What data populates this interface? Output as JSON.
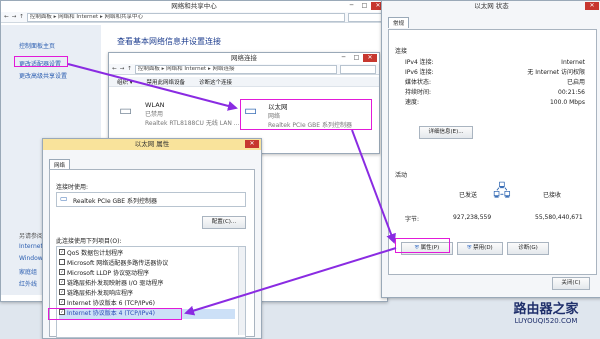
{
  "bg_window": {
    "title": "网络和共享中心",
    "breadcrumb": [
      "控制面板",
      "网络和 Internet",
      "网络和共享中心"
    ],
    "heading": "查看基本网络信息并设置连接",
    "sidebar": {
      "items": [
        "控制面板主页",
        "更改适配器设置",
        "更改高级共享设置"
      ],
      "see_also_title": "另请参阅",
      "see_also": [
        "Internet",
        "Window",
        "家庭组",
        "红外线"
      ]
    }
  },
  "net_conn": {
    "title": "网络连接",
    "breadcrumb": [
      "控制面板",
      "网络和 Internet",
      "网络连接"
    ],
    "toolbar": {
      "organize": "组织 ▾",
      "disable": "禁用此网络设备",
      "diagnose": "诊断这个连接"
    },
    "adapters": [
      {
        "name": "WLAN",
        "status": "已禁用",
        "device": "Realtek RTL8188CU 无线 LAN ..."
      },
      {
        "name": "以太网",
        "status": "网络",
        "device": "Realtek PCIe GBE 系列控制器"
      }
    ]
  },
  "props": {
    "title": "以太网 属性",
    "tab": "网络",
    "connect_using_label": "连接时使用:",
    "device": "Realtek PCIe GBE 系列控制器",
    "configure_btn": "配置(C)...",
    "items_label": "此连接使用下列项目(O):",
    "items": [
      "QoS 数据包计划程序",
      "Microsoft 网络适配器多路传送器协议",
      "Microsoft LLDP 协议驱动程序",
      "链路层拓扑发现映射器 I/O 驱动程序",
      "链路层拓扑发现响应程序",
      "Internet 协议版本 6 (TCP/IPv6)",
      "Internet 协议版本 4 (TCP/IPv4)"
    ]
  },
  "status": {
    "title": "以太网 状态",
    "tab": "常规",
    "connection_title": "连接",
    "rows": [
      {
        "label": "IPv4 连接:",
        "value": "Internet"
      },
      {
        "label": "IPv6 连接:",
        "value": "无 Internet 访问权限"
      },
      {
        "label": "媒体状态:",
        "value": "已启用"
      },
      {
        "label": "持续时间:",
        "value": "00:21:56"
      },
      {
        "label": "速度:",
        "value": "100.0 Mbps"
      }
    ],
    "details_btn": "详细信息(E)...",
    "activity_title": "活动",
    "sent_label": "已发送",
    "recv_label": "已接收",
    "bytes_label": "字节:",
    "bytes_sent": "927,238,559",
    "bytes_recv": "55,580,440,671",
    "props_btn": "属性(P)",
    "disable_btn": "禁用(D)",
    "diagnose_btn": "诊断(G)",
    "close_btn": "关闭(C)"
  },
  "watermark": {
    "line1": "路由器之家",
    "line2": "LUYOUQI520.COM"
  },
  "colors": {
    "highlight": "#e21ad8",
    "arrow": "#8a2be2",
    "link": "#2a5db0"
  }
}
